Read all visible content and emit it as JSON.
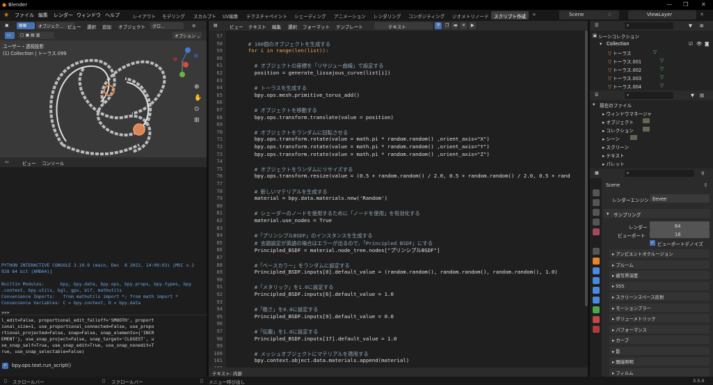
{
  "window": {
    "title": "Blender"
  },
  "menus": [
    "ファイル",
    "編集",
    "レンダー",
    "ウィンドウ",
    "ヘルプ"
  ],
  "workspace_tabs": [
    "レイアウト",
    "モデリング",
    "スカルプト",
    "UV編集",
    "テクスチャペイント",
    "シェーディング",
    "アニメーション",
    "レンダリング",
    "コンポジティング",
    "ジオメトリノード",
    "スクリプト作成"
  ],
  "active_tab": "スクリプト作成",
  "scene": "Scene",
  "view_layer": "ViewLayer",
  "viewport": {
    "header": [
      "オブジェク...",
      "ビュー",
      "選択",
      "追加",
      "オブジェクト",
      "グロ...",
      "オプション ⌄"
    ],
    "info1": "ユーザー・透視投影",
    "info2": "(1) Collection | トーラス.099"
  },
  "console": {
    "header": [
      "ビュー",
      "コンソール"
    ],
    "banner": [
      "PYTHON INTERACTIVE CONSOLE 3.10.9 (main, Dec  8 2022, 14:09:03) [MSC v.1",
      "928 64 bit (AMD64)]",
      "",
      "Builtin Modules:      bpy, bpy.data, bpy.ops, bpy.props, bpy.types, bpy",
      ".context, bpy.utils, bgl, gpu, blf, mathutils",
      "Convenience Imports:   from mathutils import *; from math import *",
      "Convenience Variables: C = bpy.context, D = bpy.data"
    ],
    "prompt": ">>> ",
    "output": [
      "l_edit=False, proportional_edit_falloff='SMOOTH', proport",
      "ional_size=1, use_proportional_connected=False, use_propo",
      "rtional_projected=False, snap=False, snap_elements={'INCR",
      "EMENT'}, use_snap_project=False, snap_target='CLOSEST', u",
      "se_snap_self=True, use_snap_edit=True, use_snap_nonedit=T",
      "rue, use_snap_selectable=False)"
    ],
    "last_cmd": "bpy.ops.text.run_script()"
  },
  "text_editor": {
    "header": [
      "ビュー",
      "テキスト",
      "編集",
      "選択",
      "フォーマット",
      "テンプレート",
      "テキスト"
    ],
    "footer": "テキスト: 内部",
    "lines": [
      {
        "n": "57",
        "t": ""
      },
      {
        "n": "58",
        "t": "    # 100個のオブジェクトを生成する"
      },
      {
        "n": "59",
        "t": "    for i in range(len(list)):"
      },
      {
        "n": "60",
        "t": ""
      },
      {
        "n": "61",
        "t": "      # オブジェクトの座標を「リサジュー曲線」で設定する"
      },
      {
        "n": "62",
        "t": "      position = generate_lissajous_curve(list[i])"
      },
      {
        "n": "63",
        "t": ""
      },
      {
        "n": "64",
        "t": "      # トーラスを生成する"
      },
      {
        "n": "65",
        "t": "      bpy.ops.mesh.primitive_torus_add()"
      },
      {
        "n": "66",
        "t": ""
      },
      {
        "n": "67",
        "t": "      # オブジェクトを移動する"
      },
      {
        "n": "68",
        "t": "      bpy.ops.transform.translate(value = position)"
      },
      {
        "n": "69",
        "t": ""
      },
      {
        "n": "70",
        "t": "      # オブジェクトをランダムに回転させる"
      },
      {
        "n": "71",
        "t": "      bpy.ops.transform.rotate(value = math.pi * random.random() ,orient_axis=\"X\")"
      },
      {
        "n": "72",
        "t": "      bpy.ops.transform.rotate(value = math.pi * random.random() ,orient_axis=\"Y\")"
      },
      {
        "n": "73",
        "t": "      bpy.ops.transform.rotate(value = math.pi * random.random() ,orient_axis=\"Z\")"
      },
      {
        "n": "74",
        "t": ""
      },
      {
        "n": "75",
        "t": "      # オブジェクトをランダムにリサイズする"
      },
      {
        "n": "76",
        "t": "      bpy.ops.transform.resize(value = (0.5 + random.random() / 2.0, 0.5 + random.random() / 2.0, 0.5 + rand"
      },
      {
        "n": "77",
        "t": ""
      },
      {
        "n": "78",
        "t": "      # 新しいマテリアルを生成する"
      },
      {
        "n": "79",
        "t": "      material = bpy.data.materials.new('Random')"
      },
      {
        "n": "80",
        "t": ""
      },
      {
        "n": "81",
        "t": "      # シェーダーのノードを使用するために「ノードを使用」を有効化する"
      },
      {
        "n": "82",
        "t": "      material.use_nodes = True"
      },
      {
        "n": "83",
        "t": ""
      },
      {
        "n": "84",
        "t": "      #「プリンシプルBSDF」のインスタンスを生成する"
      },
      {
        "n": "85",
        "t": "      # 言語設定が英語の場合はエラーが出るので、「Principled BSDF」にする"
      },
      {
        "n": "86",
        "t": "      Principled_BSDF = material.node_tree.nodes[\"プリンシプルBSDF\"]"
      },
      {
        "n": "87",
        "t": ""
      },
      {
        "n": "88",
        "t": "      #「ベースカラー」をランダムに設定する"
      },
      {
        "n": "89",
        "t": "      Principled_BSDF.inputs[0].default_value = (random.random(), random.random(), random.random(), 1.0)"
      },
      {
        "n": "90",
        "t": ""
      },
      {
        "n": "91",
        "t": "      #「メタリック」を1.0に設定する"
      },
      {
        "n": "92",
        "t": "      Principled_BSDF.inputs[6].default_value = 1.0"
      },
      {
        "n": "93",
        "t": ""
      },
      {
        "n": "94",
        "t": "      #「粗さ」を0.0に設定する"
      },
      {
        "n": "95",
        "t": "      Principled_BSDF.inputs[9].default_value = 0.0"
      },
      {
        "n": "96",
        "t": ""
      },
      {
        "n": "97",
        "t": "      #「伝搬」を1.0に設定する"
      },
      {
        "n": "98",
        "t": "      Principled_BSDF.inputs[17].default_value = 1.0"
      },
      {
        "n": "99",
        "t": ""
      },
      {
        "n": "100",
        "t": "      # メッシュオブジェクトにマテリアルを適用する"
      },
      {
        "n": "101",
        "t": "      bpy.context.object.data.materials.append(material)"
      },
      {
        "n": "102",
        "t": ""
      }
    ]
  },
  "outliner": {
    "root": "シーンコレクション",
    "collection": "Collection",
    "items": [
      "トーラス",
      "トーラス.001",
      "トーラス.002",
      "トーラス.003",
      "トーラス.004"
    ]
  },
  "file_browser": {
    "root": "現在のファイル",
    "items": [
      "ウィンドウマネージャ",
      "オブジェクト",
      "コレクション",
      "シーン",
      "スクリーン",
      "テキスト",
      "パレット"
    ]
  },
  "properties": {
    "scene": "Scene",
    "engine_label": "レンダーエンジン",
    "engine": "Eevee",
    "sampling": "サンプリング",
    "render_label": "レンダー",
    "render_val": "64",
    "viewport_label": "ビューポート",
    "viewport_val": "16",
    "denoise": "ビューポートデノイズ",
    "sections": [
      "アンビエントオクルージョン",
      "ブルーム",
      "被写界深度",
      "SSS",
      "スクリーンスペース反射",
      "モーションブラー",
      "ボリューメトリック",
      "パフォーマンス",
      "カーブ",
      "影",
      "間接照明",
      "フィルム"
    ]
  },
  "status": {
    "left": "スクロールバー",
    "mid": "スクロールバー",
    "center": "メニュー呼び出し",
    "version": "3.5.0"
  }
}
